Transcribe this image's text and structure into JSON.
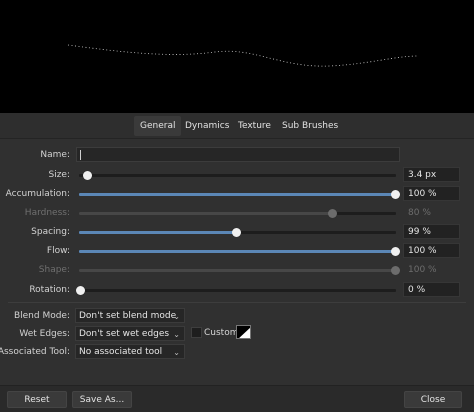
{
  "preview": {
    "stroke_icon": "brush-stroke-preview"
  },
  "tabs": [
    {
      "label": "General",
      "active": true
    },
    {
      "label": "Dynamics",
      "active": false
    },
    {
      "label": "Texture",
      "active": false
    },
    {
      "label": "Sub Brushes",
      "active": false
    }
  ],
  "name": {
    "label": "Name:",
    "value": ""
  },
  "sliders": [
    {
      "key": "size",
      "label": "Size:",
      "value_text": "3.4 px",
      "position": 0.025,
      "enabled": true,
      "filled": false
    },
    {
      "key": "accumulation",
      "label": "Accumulation:",
      "value_text": "100 %",
      "position": 1.0,
      "enabled": true,
      "filled": true
    },
    {
      "key": "hardness",
      "label": "Hardness:",
      "value_text": "80 %",
      "position": 0.8,
      "enabled": false,
      "filled": true
    },
    {
      "key": "spacing",
      "label": "Spacing:",
      "value_text": "99 %",
      "position": 0.5,
      "enabled": true,
      "filled": true
    },
    {
      "key": "flow",
      "label": "Flow:",
      "value_text": "100 %",
      "position": 1.0,
      "enabled": true,
      "filled": true
    },
    {
      "key": "shape",
      "label": "Shape:",
      "value_text": "100 %",
      "position": 1.0,
      "enabled": false,
      "filled": true
    },
    {
      "key": "rotation",
      "label": "Rotation:",
      "value_text": "0 %",
      "position": 0.0,
      "enabled": true,
      "filled": false
    }
  ],
  "blend_mode": {
    "label": "Blend Mode:",
    "value": "Don't set blend mode"
  },
  "wet_edges": {
    "label": "Wet Edges:",
    "value": "Don't set wet edges",
    "custom_label": "Custom",
    "custom_checked": false
  },
  "associated_tool": {
    "label": "Associated Tool:",
    "value": "No associated tool"
  },
  "footer": {
    "reset": "Reset",
    "save_as": "Save As...",
    "close": "Close"
  },
  "colors": {
    "accent": "#5b87b6",
    "panel": "#303030",
    "preview": "#000000"
  }
}
